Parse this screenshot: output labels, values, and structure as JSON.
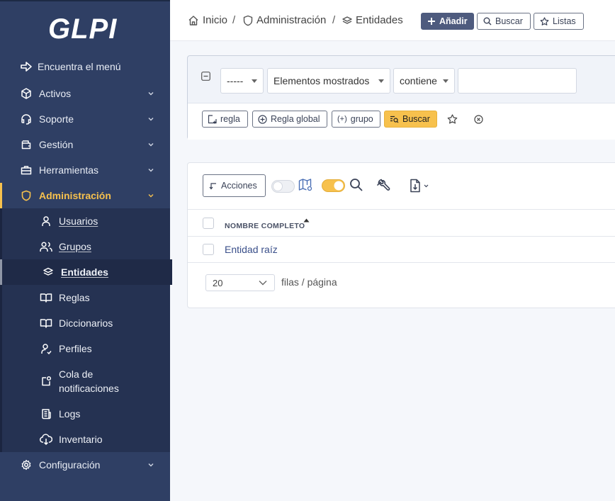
{
  "app": {
    "logo_text": "GLPI"
  },
  "sidebar": {
    "find_menu": "Encuentra el menú",
    "items": [
      {
        "label": "Activos",
        "icon": "cube-icon"
      },
      {
        "label": "Soporte",
        "icon": "headset-icon"
      },
      {
        "label": "Gestión",
        "icon": "wallet-icon"
      },
      {
        "label": "Herramientas",
        "icon": "briefcase-icon"
      },
      {
        "label": "Administración",
        "icon": "shield-icon"
      }
    ],
    "admin_sub": [
      {
        "label": "Usuarios",
        "icon": "user-icon"
      },
      {
        "label": "Grupos",
        "icon": "users-icon"
      },
      {
        "label": "Entidades",
        "icon": "layers-icon"
      },
      {
        "label": "Reglas",
        "icon": "book-icon"
      },
      {
        "label": "Diccionarios",
        "icon": "book-icon"
      },
      {
        "label": "Perfiles",
        "icon": "user-check-icon"
      },
      {
        "label": "Cola de notificaciones",
        "icon": "notification-icon"
      },
      {
        "label": "Logs",
        "icon": "news-icon"
      },
      {
        "label": "Inventario",
        "icon": "cloud-download-icon"
      }
    ],
    "config": "Configuración"
  },
  "header": {
    "breadcrumb": [
      "Inicio",
      "Administración",
      "Entidades"
    ],
    "add_label": "Añadir",
    "search_label": "Buscar",
    "lists_label": "Listas"
  },
  "search": {
    "field1": "-----",
    "field2": "Elementos mostrados",
    "field3": "contiene",
    "value": "",
    "rule_label": "regla",
    "global_rule_label": "Regla global",
    "group_label": "grupo",
    "search_label": "Buscar"
  },
  "results": {
    "actions_label": "Acciones",
    "column_header": "NOMBRE COMPLETO",
    "rows": [
      "Entidad raíz"
    ],
    "per_page_value": "20",
    "per_page_label": "filas / página"
  },
  "colors": {
    "sidebar_bg": "#2f3f64",
    "accent": "#f7c14d",
    "primary_btn": "#4e5b7e",
    "link": "#3a4f8a"
  }
}
